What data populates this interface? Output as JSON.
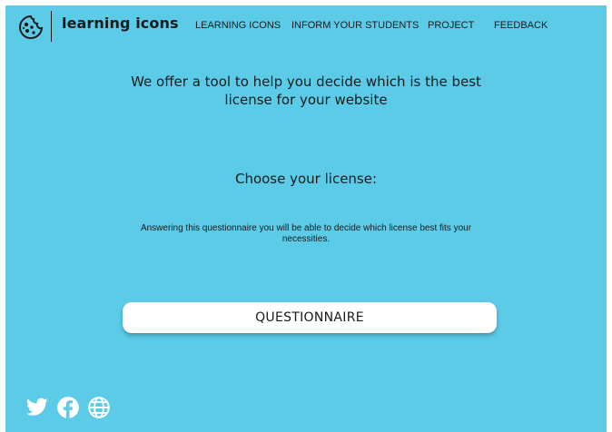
{
  "header": {
    "brand": "learning icons",
    "nav": [
      "LEARNING ICONS",
      "INFORM YOUR STUDENTS",
      "PROJECT",
      "FEEDBACK"
    ]
  },
  "main": {
    "intro_line1": "We offer a tool to help you decide which is the best",
    "intro_line2": "license for your website",
    "choose_title": "Choose your license:",
    "desc_line1": "Answering this questionnaire you will be able to decide which license best fits your",
    "desc_line2": "necessities.",
    "button_label": "QUESTIONNAIRE"
  },
  "footer": {
    "icons": [
      "twitter-icon",
      "facebook-icon",
      "globe-icon"
    ]
  },
  "colors": {
    "background": "#5bcbe8",
    "text": "#1a1a1a",
    "button": "#ffffff"
  }
}
